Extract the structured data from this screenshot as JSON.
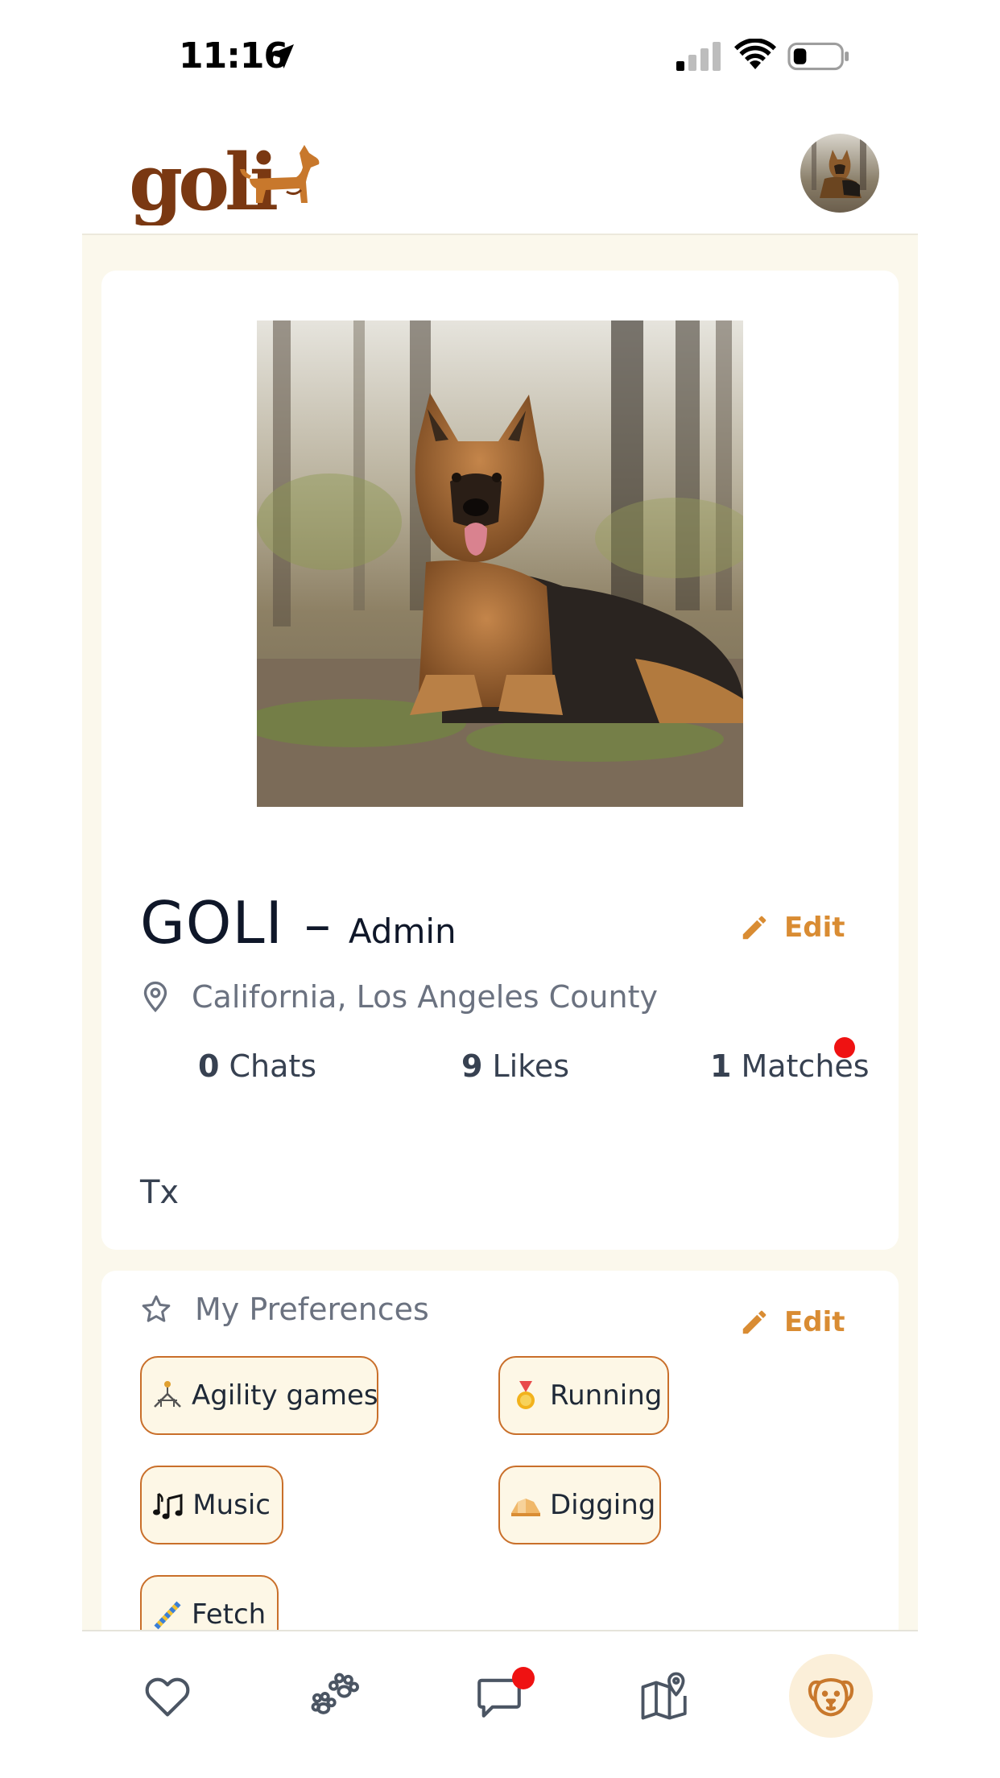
{
  "status_bar": {
    "time": "11:16"
  },
  "header": {
    "logo_text": "goli",
    "avatar_icon": "dog-avatar-photo"
  },
  "profile": {
    "name": "GOLI",
    "dash": "–",
    "role": "Admin",
    "edit_label": "Edit",
    "location": "California, Los Angeles County",
    "stats": {
      "chats_count": "0",
      "chats_label": "Chats",
      "likes_count": "9",
      "likes_label": "Likes",
      "matches_count": "1",
      "matches_label": "Matches"
    },
    "bio": "Tx",
    "accent_color": "#d98c33"
  },
  "preferences": {
    "title": "My Preferences",
    "edit_label": "Edit",
    "chips": [
      {
        "label": "Agility games",
        "icon": "agility-icon"
      },
      {
        "label": "Running",
        "icon": "medal-icon"
      },
      {
        "label": "Music",
        "icon": "music-notes-icon"
      },
      {
        "label": "Digging",
        "icon": "digging-icon"
      },
      {
        "label": "Fetch",
        "icon": "rope-toy-icon"
      }
    ]
  },
  "bottom_nav": {
    "items": [
      "heart-icon",
      "paws-icon",
      "chat-icon",
      "map-icon",
      "dog-face-icon"
    ],
    "active": "dog-face-icon"
  }
}
